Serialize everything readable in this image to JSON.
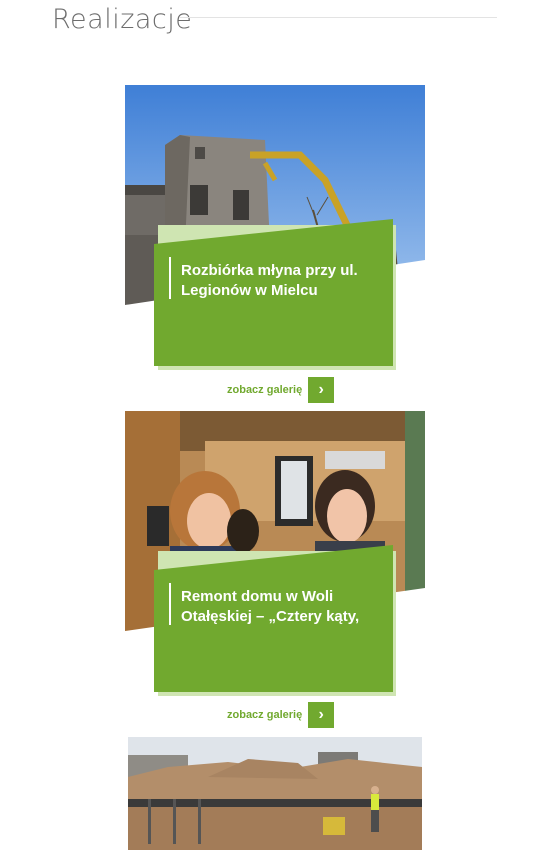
{
  "section": {
    "title": "Realizacje"
  },
  "colors": {
    "accent": "#71a92f",
    "accent_light": "#cfe5b2",
    "title_text": "#6d6d6d"
  },
  "realizations": [
    {
      "title": "Rozbiórka młyna przy ul. Legionów w Mielcu",
      "link_label": "zobacz galerię",
      "arrow": "›",
      "image": "demolition-excavator-photo"
    },
    {
      "title": "Remont domu w Woli Otałęskiej – „Cztery kąty,",
      "link_label": "zobacz galerię",
      "arrow": "›",
      "image": "tv-crew-women-photo"
    },
    {
      "image": "construction-site-photo"
    }
  ]
}
